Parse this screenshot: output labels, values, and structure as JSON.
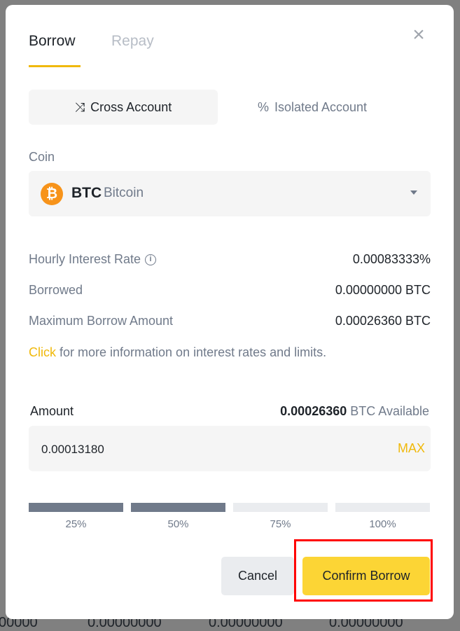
{
  "background": {
    "row": [
      "00000",
      "0.00000000",
      "0.00000000",
      "0.00000000"
    ]
  },
  "tabs": [
    {
      "label": "Borrow",
      "active": true
    },
    {
      "label": "Repay",
      "active": false
    }
  ],
  "account_types": [
    {
      "label": "Cross Account",
      "icon": "arrows-cross-icon",
      "selected": true
    },
    {
      "label": "Isolated Account",
      "icon": "percent-icon",
      "selected": false
    }
  ],
  "coin": {
    "label": "Coin",
    "symbol": "BTC",
    "name": "Bitcoin",
    "icon_glyph": "₿"
  },
  "details": [
    {
      "label": "Hourly Interest Rate",
      "value": "0.00083333%",
      "info": true
    },
    {
      "label": "Borrowed",
      "value": "0.00000000 BTC"
    },
    {
      "label": "Maximum Borrow Amount",
      "value": "0.00026360 BTC"
    }
  ],
  "info_line": {
    "link": "Click",
    "text": " for more information on interest rates and limits."
  },
  "amount": {
    "label": "Amount",
    "available_value": "0.00026360",
    "available_suffix": " BTC Available",
    "value": "0.00013180",
    "max_label": "MAX"
  },
  "slider": {
    "level_percent": 50,
    "steps": [
      "25%",
      "50%",
      "75%",
      "100%"
    ]
  },
  "buttons": {
    "cancel": "Cancel",
    "confirm": "Confirm Borrow"
  },
  "colors": {
    "accent": "#f0b90b",
    "confirm": "#fcd535",
    "filled": "#707a8a",
    "empty": "#eaecef",
    "highlight": "#ff0000"
  }
}
